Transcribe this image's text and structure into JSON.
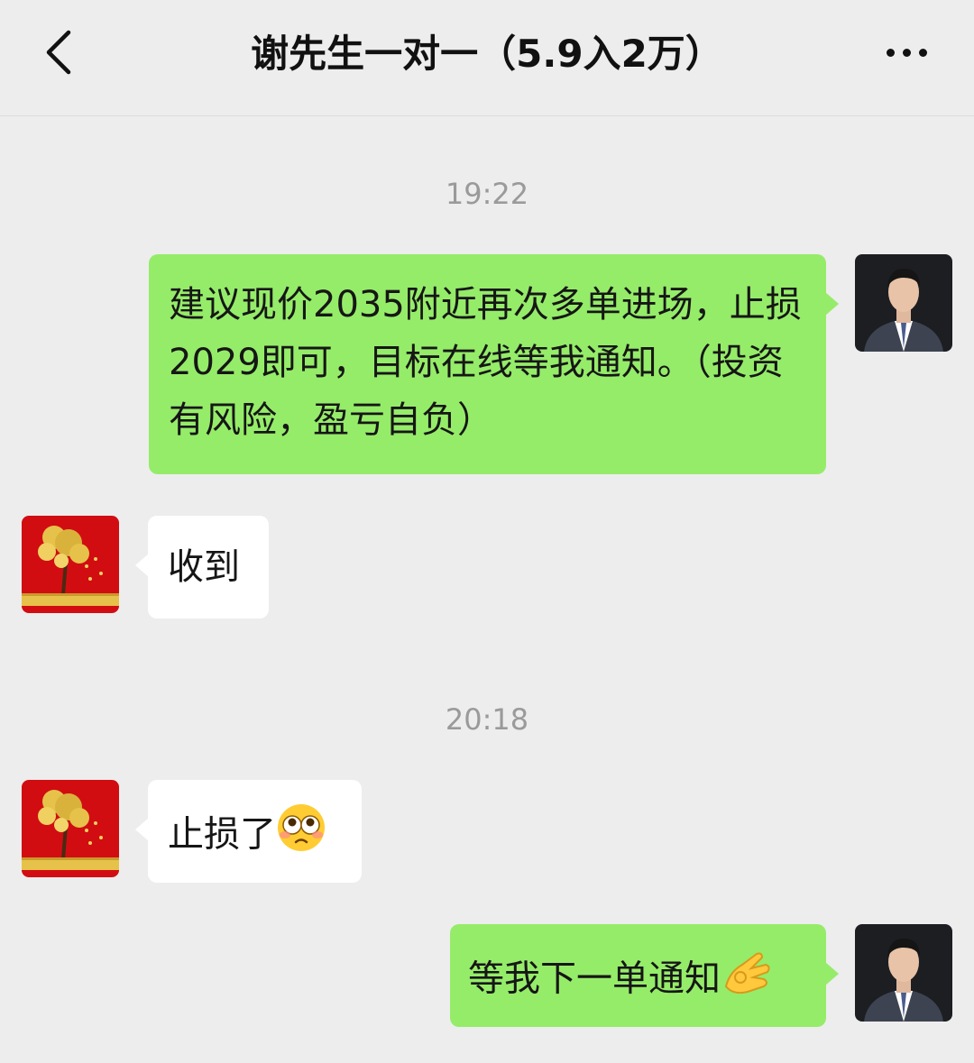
{
  "header": {
    "title": "谢先生一对一（5.9入2万）",
    "back_icon": "chevron-left-icon",
    "more_icon": "ellipsis-icon"
  },
  "messages": [
    {
      "type": "time",
      "text": "19:22"
    },
    {
      "type": "outgoing",
      "text": "建议现价2035附近再次多单进场，止损2029即可，目标在线等我通知。（投资有风险，盈亏自负）"
    },
    {
      "type": "incoming",
      "text": "收到"
    },
    {
      "type": "time",
      "text": "20:18"
    },
    {
      "type": "incoming",
      "text": "止损了",
      "emoji": "pleading-face-emoji"
    },
    {
      "type": "outgoing",
      "text": "等我下一单通知",
      "emoji": "ok-hand-emoji"
    }
  ],
  "colors": {
    "background": "#ededed",
    "outgoing_bubble": "#95ec69",
    "incoming_bubble": "#ffffff",
    "timestamp": "#9a9a9a"
  }
}
